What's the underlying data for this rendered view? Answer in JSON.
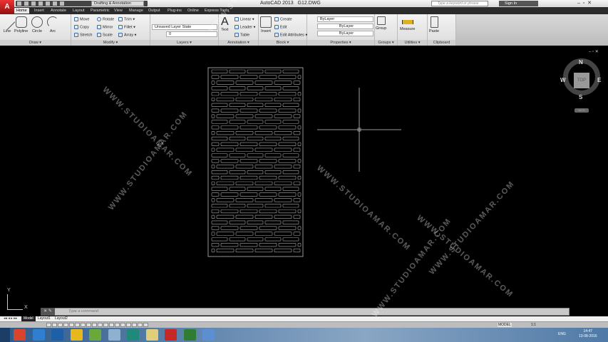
{
  "app": {
    "title": "AutoCAD 2013",
    "file": "G12.DWG",
    "workspace": "Drafting & Annotation",
    "search_placeholder": "Type a keyword or phrase",
    "sign_in": "Sign In",
    "logo": "A"
  },
  "tabs": [
    "Home",
    "Insert",
    "Annotate",
    "Layout",
    "Parametric",
    "View",
    "Manage",
    "Output",
    "Plug-ins",
    "Online",
    "Express Tools"
  ],
  "draw": {
    "title": "Draw ▾",
    "line": "Line",
    "polyline": "Polyline",
    "circle": "Circle",
    "arc": "Arc"
  },
  "modify": {
    "title": "Modify ▾",
    "move": "Move",
    "rotate": "Rotate",
    "trim": "Trim ▾",
    "copy": "Copy",
    "mirror": "Mirror",
    "fillet": "Fillet ▾",
    "stretch": "Stretch",
    "scale": "Scale",
    "array": "Array ▾"
  },
  "layers": {
    "title": "Layers ▾",
    "state": "Unsaved Layer State",
    "current": "0"
  },
  "annotation": {
    "title": "Annotation ▾",
    "text": "Text",
    "linear": "Linear ▾",
    "leader": "Leader ▾",
    "table": "Table"
  },
  "block": {
    "title": "Block ▾",
    "insert": "Insert",
    "create": "Create",
    "edit": "Edit",
    "edit_attributes": "Edit Attributes ▾"
  },
  "properties": {
    "title": "Properties ▾",
    "color": "ByLayer",
    "lineweight": "ByLayer",
    "linetype": "ByLayer"
  },
  "groups": {
    "title": "Groups ▾",
    "group": "Group"
  },
  "utilities": {
    "title": "Utilities ▾",
    "measure": "Measure"
  },
  "clipboard": {
    "title": "Clipboard",
    "paste": "Paste"
  },
  "viewcube": {
    "n": "N",
    "s": "S",
    "e": "E",
    "w": "W",
    "top": "TOP",
    "wcs": "WCS"
  },
  "ucs": {
    "x": "X",
    "y": "Y"
  },
  "command": {
    "placeholder": "Type a command"
  },
  "layout_tabs": [
    "Model",
    "Layout1",
    "Layout2"
  ],
  "status": {
    "model": "MODEL",
    "scale": "1:1"
  },
  "taskbar": {
    "lang": "ENG",
    "time": "14:47",
    "date": "13-08-2016"
  },
  "watermark": "WWW.STUDIOAMAR.COM"
}
